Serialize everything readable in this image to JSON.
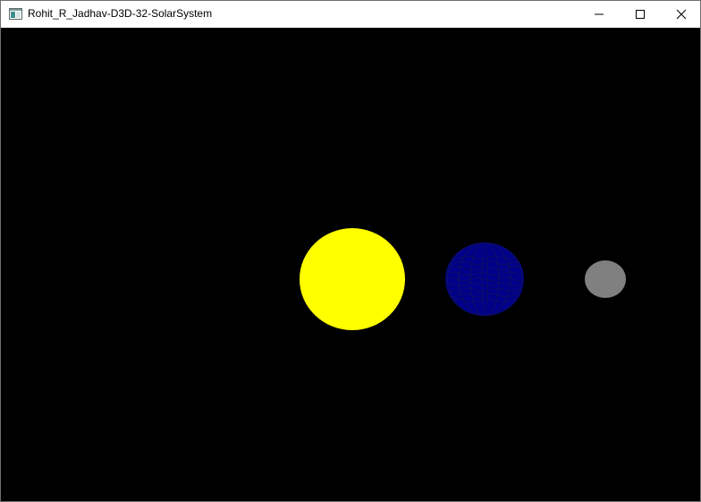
{
  "window": {
    "title": "Rohit_R_Jadhav-D3D-32-SolarSystem"
  },
  "icons": {
    "app": "window-app-icon",
    "minimize": "minimize-icon",
    "maximize": "maximize-icon",
    "close": "close-icon"
  },
  "colors": {
    "background": "#000000",
    "sun": "#ffff00",
    "earth": "#00008b",
    "earth_mesh": "#1a1a6e",
    "moon": "#808080"
  }
}
